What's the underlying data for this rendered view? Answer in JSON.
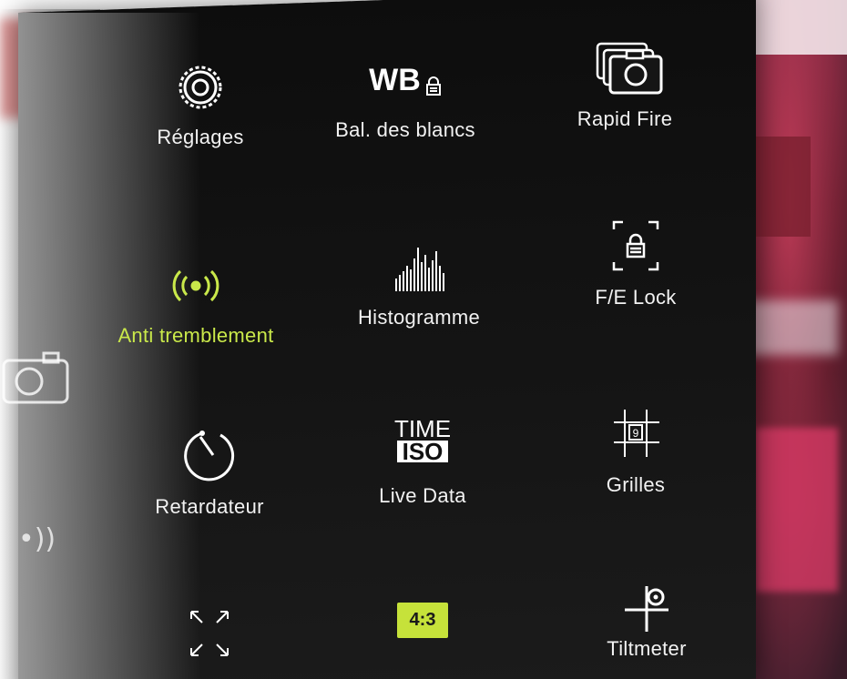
{
  "menu": {
    "tiles": [
      {
        "label": "Réglages",
        "icon": "gear-icon",
        "active": false
      },
      {
        "label": "Bal. des blancs",
        "icon_text": "WB",
        "icon": "wb-lock-icon",
        "active": false
      },
      {
        "label": "Rapid Fire",
        "icon": "burst-camera-icon",
        "active": false
      },
      {
        "label": "Anti tremblement",
        "icon": "stabilizer-icon",
        "active": true
      },
      {
        "label": "Histogramme",
        "icon": "histogram-icon",
        "active": false
      },
      {
        "label": "F/E Lock",
        "icon": "focus-lock-icon",
        "active": false
      },
      {
        "label": "Retardateur",
        "icon": "timer-icon",
        "active": false
      },
      {
        "label": "Live Data",
        "icon_text_top": "TIME",
        "icon_text_bottom": "ISO",
        "icon": "live-data-icon",
        "active": false
      },
      {
        "label": "Grilles",
        "icon": "grid-icon",
        "active": false
      },
      {
        "label": "",
        "icon": "expand-arrows-icon",
        "active": false
      },
      {
        "label": "",
        "icon_text": "4:3",
        "icon": "aspect-ratio-icon",
        "active": false
      },
      {
        "label": "Tiltmeter",
        "icon": "tiltmeter-icon",
        "active": false
      }
    ]
  },
  "colors": {
    "panel_bg": "#0d0d0d",
    "text": "#f2f2f2",
    "accent": "#c9e84a",
    "ratio_bg": "#c6e23a"
  }
}
